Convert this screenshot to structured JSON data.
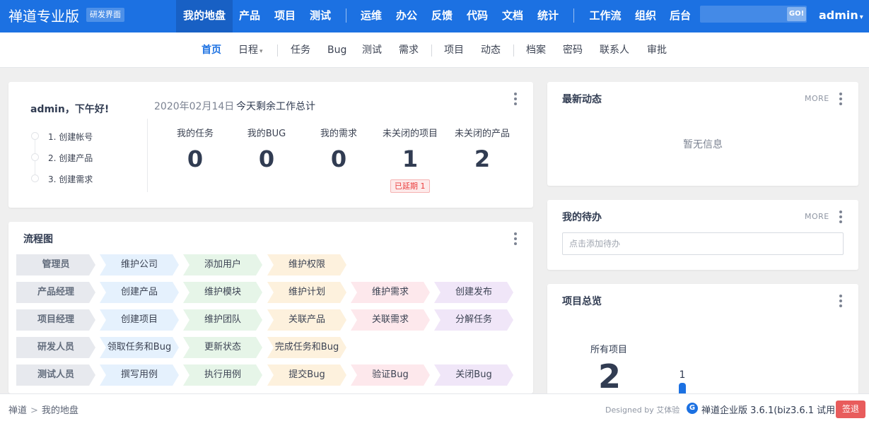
{
  "header": {
    "brand": "禅道专业版",
    "edition": "研发界面",
    "nav": [
      {
        "label": "我的地盘",
        "active": true
      },
      {
        "label": "产品"
      },
      {
        "label": "项目"
      },
      {
        "label": "测试"
      },
      {
        "label": "运维"
      },
      {
        "label": "办公"
      },
      {
        "label": "反馈"
      },
      {
        "label": "代码"
      },
      {
        "label": "文档"
      },
      {
        "label": "统计"
      },
      {
        "label": "工作流"
      },
      {
        "label": "组织"
      },
      {
        "label": "后台"
      }
    ],
    "search_button": "GO!",
    "user": "admin"
  },
  "subnav": {
    "items": [
      {
        "label": "首页",
        "active": true
      },
      {
        "label": "日程",
        "dropdown": true
      },
      {
        "label": "任务"
      },
      {
        "label": "Bug"
      },
      {
        "label": "测试"
      },
      {
        "label": "需求"
      },
      {
        "label": "项目"
      },
      {
        "label": "动态"
      },
      {
        "label": "档案"
      },
      {
        "label": "密码"
      },
      {
        "label": "联系人"
      },
      {
        "label": "审批"
      }
    ]
  },
  "welcome": {
    "greeting": "admin，下午好!",
    "steps": [
      "1. 创建帐号",
      "2. 创建产品",
      "3. 创建需求"
    ],
    "date": "2020年02月14日",
    "summary_title": "今天剩余工作总计",
    "stats": [
      {
        "label": "我的任务",
        "value": "0"
      },
      {
        "label": "我的BUG",
        "value": "0"
      },
      {
        "label": "我的需求",
        "value": "0"
      },
      {
        "label": "未关闭的项目",
        "value": "1"
      },
      {
        "label": "未关闭的产品",
        "value": "2"
      }
    ],
    "delay_badge": "已延期 1"
  },
  "flowchart": {
    "title": "流程图",
    "rows": [
      {
        "role": "管理员",
        "steps": [
          "维护公司",
          "添加用户",
          "维护权限"
        ]
      },
      {
        "role": "产品经理",
        "steps": [
          "创建产品",
          "维护模块",
          "维护计划",
          "维护需求",
          "创建发布"
        ]
      },
      {
        "role": "项目经理",
        "steps": [
          "创建项目",
          "维护团队",
          "关联产品",
          "关联需求",
          "分解任务"
        ]
      },
      {
        "role": "研发人员",
        "steps": [
          "领取任务和Bug",
          "更新状态",
          "完成任务和Bug"
        ]
      },
      {
        "role": "测试人员",
        "steps": [
          "撰写用例",
          "执行用例",
          "提交Bug",
          "验证Bug",
          "关闭Bug"
        ]
      }
    ],
    "step_colors": [
      "#e5f1fd",
      "#e6f5e8",
      "#fdf1dd",
      "#fde8ec",
      "#f0e6f8"
    ]
  },
  "dynamics": {
    "title": "最新动态",
    "more": "MORE",
    "empty": "暂无信息"
  },
  "todo": {
    "title": "我的待办",
    "more": "MORE",
    "placeholder": "点击添加待办"
  },
  "project_overview": {
    "title": "项目总览",
    "all_label": "所有项目",
    "all_count": "2",
    "bar_value": "1"
  },
  "footer": {
    "breadcrumb": [
      "禅道",
      "我的地盘"
    ],
    "designed_by": "Designed by 艾体验",
    "version": "禅道企业版 3.6.1(biz3.6.1 试用)",
    "feedback": "签退"
  },
  "colors": {
    "primary": "#1c71e2",
    "danger": "#e85c5c"
  }
}
